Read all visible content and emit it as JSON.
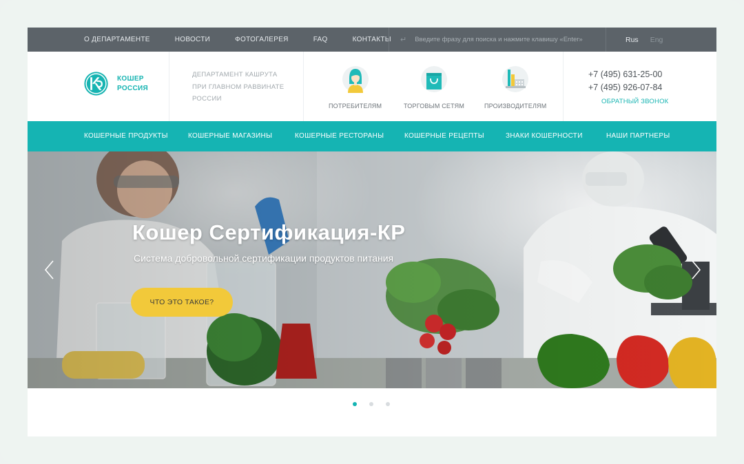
{
  "topbar": {
    "nav": [
      "О ДЕПАРТАМЕНТЕ",
      "НОВОСТИ",
      "ФОТОГАЛЕРЕЯ",
      "FAQ",
      "КОНТАКТЫ"
    ],
    "search_placeholder": "Введите фразу для поиска и нажмите клавишу «Enter»",
    "lang_active": "Rus",
    "lang_other": "Eng"
  },
  "header": {
    "logo_line1": "КОШЕР",
    "logo_line2": "РОССИЯ",
    "dept_line1": "ДЕПАРТАМЕНТ КАШРУТА",
    "dept_line2": "ПРИ ГЛАВНОМ РАВВИНАТЕ",
    "dept_line3": "РОССИИ",
    "categories": [
      {
        "label": "ПОТРЕБИТЕЛЯМ",
        "icon": "consumer-icon"
      },
      {
        "label": "ТОРГОВЫМ СЕТЯМ",
        "icon": "shopping-bag-icon"
      },
      {
        "label": "ПРОИЗВОДИТЕЛЯМ",
        "icon": "factory-icon"
      }
    ],
    "phone1": "+7 (495) 631-25-00",
    "phone2": "+7 (495) 926-07-84",
    "callback": "ОБРАТНЫЙ ЗВОНОК"
  },
  "mainnav": [
    "КОШЕРНЫЕ ПРОДУКТЫ",
    "КОШЕРНЫЕ МАГАЗИНЫ",
    "КОШЕРНЫЕ РЕСТОРАНЫ",
    "КОШЕРНЫЕ РЕЦЕПТЫ",
    "ЗНАКИ КОШЕРНОСТИ",
    "НАШИ ПАРТНЕРЫ"
  ],
  "hero": {
    "title": "Кошер Сертификация-КР",
    "subtitle": "Система добровольной сертификации продуктов питания",
    "button": "ЧТО ЭТО ТАКОЕ?"
  },
  "slider": {
    "total_slides": 3,
    "active_slide": 1
  },
  "colors": {
    "accent": "#15b4b3",
    "topbar": "#5c6369",
    "button": "#f2c93a"
  }
}
